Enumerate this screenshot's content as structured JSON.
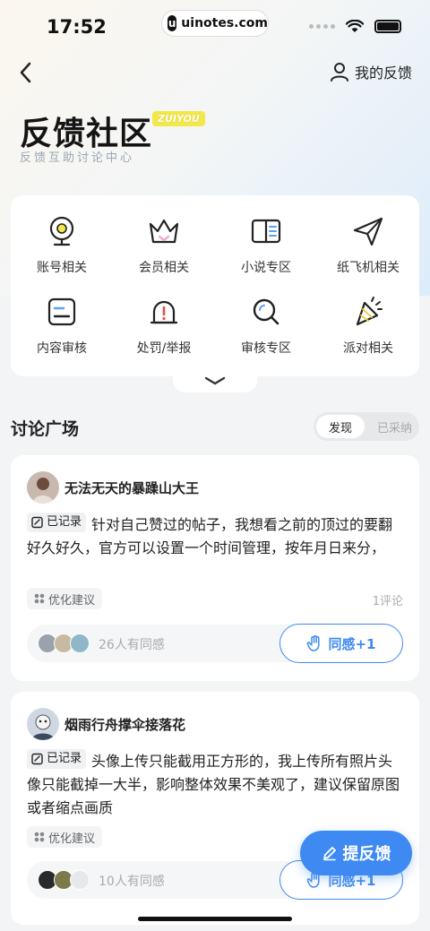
{
  "status_bar": {
    "time": "17:52",
    "url": "uinotes.com",
    "url_logo": "u"
  },
  "nav": {
    "back_icon": "chevron-left-icon",
    "my_feedback": "我的反馈"
  },
  "header": {
    "title": "反馈社区",
    "badge": "ZUIYOU",
    "subtitle": "反馈互助讨论中心"
  },
  "categories": [
    {
      "label": "账号相关",
      "icon": "webcam-icon"
    },
    {
      "label": "会员相关",
      "icon": "crown-icon"
    },
    {
      "label": "小说专区",
      "icon": "book-icon"
    },
    {
      "label": "纸飞机相关",
      "icon": "paper-plane-icon"
    },
    {
      "label": "内容审核",
      "icon": "document-icon"
    },
    {
      "label": "处罚/举报",
      "icon": "alarm-icon"
    },
    {
      "label": "审核专区",
      "icon": "search-icon"
    },
    {
      "label": "派对相关",
      "icon": "party-icon"
    }
  ],
  "discussion": {
    "title": "讨论广场",
    "tab_active": "发现",
    "tab_inactive": "已采纳"
  },
  "posts": [
    {
      "author": "无法无天的暴躁山大王",
      "recorded": "已记录",
      "body": "针对自己赞过的帖子，我想看之前的顶过的要翻好久好久，官方可以设置一个时间管理，按年月日来分，",
      "tag": "优化建议",
      "comments": "1评论",
      "empathy_count": "26人有同感",
      "empathy_btn": "同感+1"
    },
    {
      "author": "烟雨行舟撑伞接落花",
      "recorded": "已记录",
      "body": "头像上传只能截用正方形的，我上传所有照片头像只能截掉一大半，影响整体效果不美观了，建议保留原图或者缩点画质",
      "tag": "优化建议",
      "comments": "",
      "empathy_count": "10人有同感",
      "empathy_btn": "同感+1"
    }
  ],
  "fab": {
    "label": "提反馈"
  },
  "colors": {
    "accent": "#3f8af2",
    "badge": "#f2e84a"
  }
}
